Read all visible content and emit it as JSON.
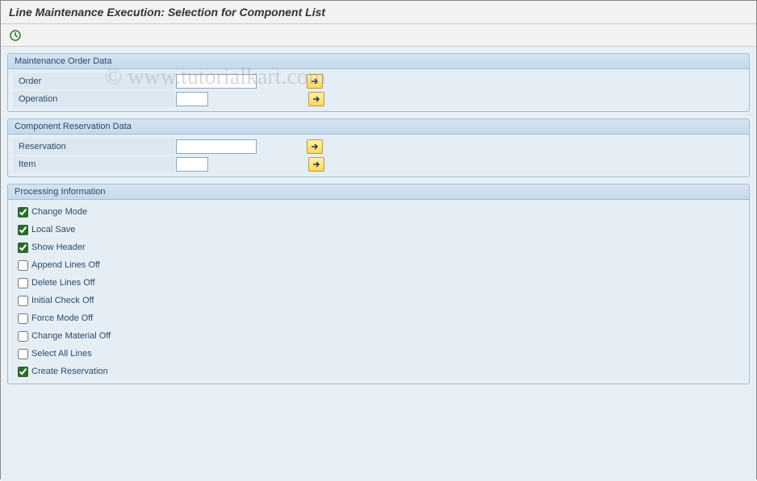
{
  "title": "Line Maintenance Execution: Selection for Component List",
  "watermark": "© www.tutorialkart.com",
  "groups": {
    "order": {
      "title": "Maintenance Order Data",
      "fields": {
        "order": {
          "label": "Order",
          "value": ""
        },
        "operation": {
          "label": "Operation",
          "value": ""
        }
      }
    },
    "reservation": {
      "title": "Component Reservation Data",
      "fields": {
        "reservation": {
          "label": "Reservation",
          "value": ""
        },
        "item": {
          "label": "Item",
          "value": ""
        }
      }
    },
    "processing": {
      "title": "Processing Information",
      "checks": {
        "change_mode": {
          "label": "Change Mode",
          "checked": true
        },
        "local_save": {
          "label": "Local Save",
          "checked": true
        },
        "show_header": {
          "label": "Show Header",
          "checked": true
        },
        "append_off": {
          "label": "Append Lines Off",
          "checked": false
        },
        "delete_off": {
          "label": "Delete Lines Off",
          "checked": false
        },
        "initial_off": {
          "label": "Initial Check Off",
          "checked": false
        },
        "force_off": {
          "label": "Force Mode Off",
          "checked": false
        },
        "change_mat_off": {
          "label": "Change Material Off",
          "checked": false
        },
        "select_all": {
          "label": "Select All Lines",
          "checked": false
        },
        "create_res": {
          "label": "Create Reservation",
          "checked": true
        }
      }
    }
  }
}
